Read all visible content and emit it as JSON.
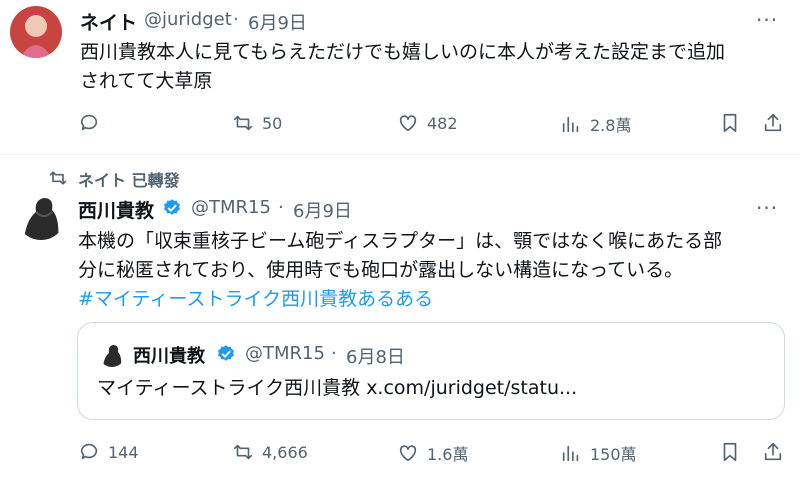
{
  "tweet1": {
    "author_name": "ネイト",
    "handle": "@juridget",
    "date": "6月9日",
    "more_label": "···",
    "text_line1": "西川貴教本人に見てもらえただけでも嬉しいのに本人が考えた設定まで追加",
    "text_line2": "されてて大草原",
    "reply_count": "",
    "retweet_count": "50",
    "like_count": "482",
    "view_count": "2.8萬"
  },
  "retweet_banner": {
    "label": "ネイト 已轉發"
  },
  "tweet2": {
    "author_name": "西川貴教",
    "handle": "@TMR15",
    "date": "6月9日",
    "more_label": "···",
    "text_line1": "本機の「収束重核子ビーム砲ディスラプター」は、顎ではなく喉にあたる部",
    "text_line2": "分に秘匿されており、使用時でも砲口が露出しない構造になっている。",
    "hashtag": "#マイティーストライク西川貴教あるある",
    "quote": {
      "author_name": "西川貴教",
      "handle": "@TMR15",
      "date": "6月8日",
      "text": "マイティーストライク西川貴教 x.com/juridget/statu..."
    },
    "reply_count": "144",
    "retweet_count": "4,666",
    "like_count": "1.6萬",
    "view_count": "150萬"
  },
  "separator": "·",
  "colors": {
    "accent": "#1d9bf0",
    "secondary_text": "#536471",
    "border": "#cfd9de"
  }
}
